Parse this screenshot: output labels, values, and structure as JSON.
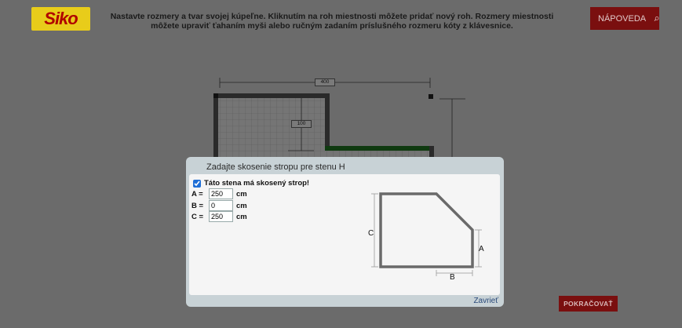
{
  "header": {
    "logo_text": "Siko",
    "instructions": "Nastavte rozmery a tvar svojej kúpeľne. Kliknutím na roh miestnosti môžete pridať nový roh. Rozmery miestnosti môžete upraviť ťahaním myši alebo ručným zadaním príslušného rozmeru kóty z klávesnice.",
    "help_label": "NÁPOVEDA"
  },
  "plan": {
    "dimension_top": "400",
    "dimension_inner": "100"
  },
  "dialog": {
    "title": "Zadajte skosenie stropu pre stenu H",
    "checkbox_label": "Táto stena má skosený strop!",
    "checkbox_checked": true,
    "fields": [
      {
        "label": "A =",
        "value": "250",
        "unit": "cm"
      },
      {
        "label": "B =",
        "value": "0",
        "unit": "cm"
      },
      {
        "label": "C =",
        "value": "250",
        "unit": "cm"
      }
    ],
    "diagram_labels": {
      "a": "A",
      "b": "B",
      "c": "C"
    },
    "close_label": "Zavrieť"
  },
  "footer": {
    "continue_label": "POKRAČOVAŤ"
  },
  "colors": {
    "background": "#6b6b6b",
    "accent_red": "#7a0f0f",
    "logo_yellow": "#e8cc1a",
    "wall_dark": "#2a2a2a",
    "wall_green": "#0f3a10"
  }
}
